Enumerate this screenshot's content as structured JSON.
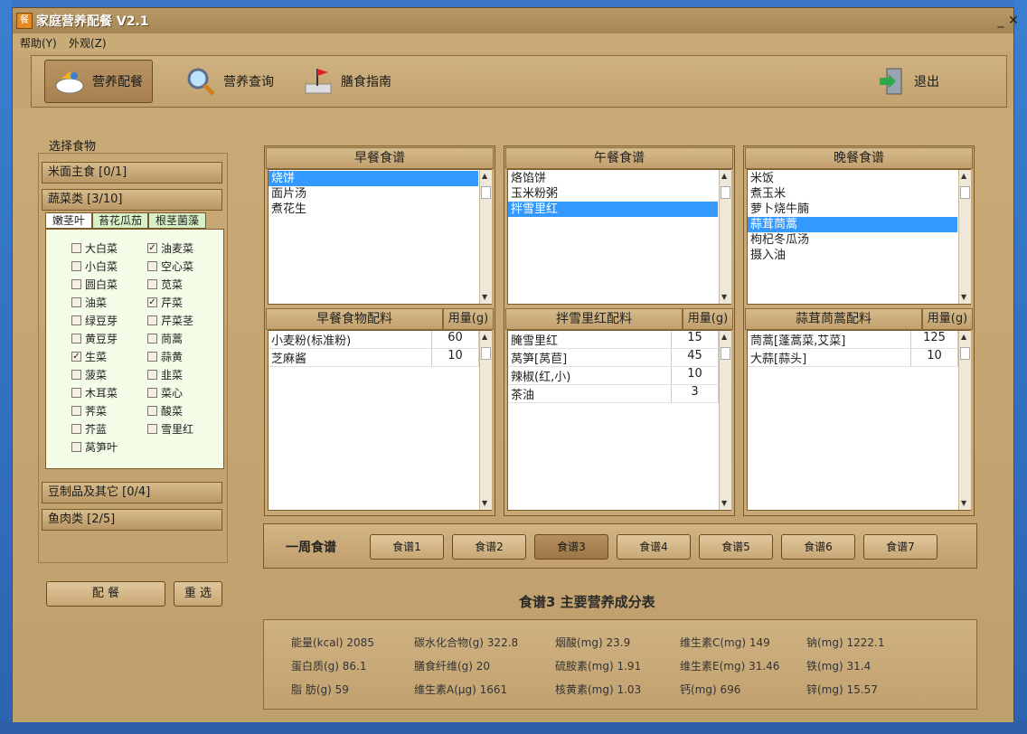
{
  "window": {
    "title": "家庭营养配餐 V2.1",
    "icon_char": "餐"
  },
  "menu": [
    "帮助(Y)",
    "外观(Z)"
  ],
  "toolbar": {
    "items": [
      {
        "label": "营养配餐",
        "icon": "bowl-icon"
      },
      {
        "label": "营养查询",
        "icon": "magnifier-icon"
      },
      {
        "label": "膳食指南",
        "icon": "flag-book-icon"
      },
      {
        "label": "退出",
        "icon": "exit-door-icon"
      }
    ]
  },
  "food_select": {
    "title": "选择食物",
    "categories": [
      "米面主食 [0/1]",
      "蔬菜类 [3/10]",
      "豆制品及其它 [0/4]",
      "鱼肉类 [2/5]"
    ],
    "tabs": [
      "嫩茎叶",
      "苔花瓜茄",
      "根茎菌藻"
    ],
    "vegetables": [
      {
        "name": "大白菜",
        "checked": false
      },
      {
        "name": "油麦菜",
        "checked": true
      },
      {
        "name": "小白菜",
        "checked": false
      },
      {
        "name": "空心菜",
        "checked": false
      },
      {
        "name": "圆白菜",
        "checked": false
      },
      {
        "name": "苋菜",
        "checked": false
      },
      {
        "name": "油菜",
        "checked": false
      },
      {
        "name": "芹菜",
        "checked": true
      },
      {
        "name": "绿豆芽",
        "checked": false
      },
      {
        "name": "芹菜茎",
        "checked": false
      },
      {
        "name": "黄豆芽",
        "checked": false
      },
      {
        "name": "茼蒿",
        "checked": false
      },
      {
        "name": "生菜",
        "checked": true
      },
      {
        "name": "蒜黄",
        "checked": false
      },
      {
        "name": "菠菜",
        "checked": false
      },
      {
        "name": "韭菜",
        "checked": false
      },
      {
        "name": "木耳菜",
        "checked": false
      },
      {
        "name": "菜心",
        "checked": false
      },
      {
        "name": "荠菜",
        "checked": false
      },
      {
        "name": "酸菜",
        "checked": false
      },
      {
        "name": "芥蓝",
        "checked": false
      },
      {
        "name": "雪里红",
        "checked": false
      },
      {
        "name": "莴笋叶",
        "checked": false
      }
    ]
  },
  "buttons": {
    "match": "配 餐",
    "reset": "重 选"
  },
  "breakfast": {
    "title": "早餐食谱",
    "items": [
      "烧饼",
      "面片汤",
      "煮花生"
    ],
    "selected": 0,
    "ingredients_title": "早餐食物配料",
    "amount_header": "用量(g)",
    "ingredients": [
      {
        "name": "小麦粉(标准粉)",
        "amount": "60"
      },
      {
        "name": "芝麻酱",
        "amount": "10"
      }
    ]
  },
  "lunch": {
    "title": "午餐食谱",
    "items": [
      "烙馅饼",
      "玉米粉粥",
      "拌雪里红"
    ],
    "selected": 2,
    "ingredients_title": "拌雪里红配料",
    "amount_header": "用量(g)",
    "ingredients": [
      {
        "name": "腌雪里红",
        "amount": "15"
      },
      {
        "name": "莴笋[莴苣]",
        "amount": "45"
      },
      {
        "name": "辣椒(红,小)",
        "amount": "10"
      },
      {
        "name": "茶油",
        "amount": "3"
      }
    ]
  },
  "dinner": {
    "title": "晚餐食谱",
    "items": [
      "米饭",
      "煮玉米",
      "萝卜烧牛腩",
      "蒜茸茼蒿",
      "枸杞冬瓜汤",
      "摄入油"
    ],
    "selected": 3,
    "ingredients_title": "蒜茸茼蒿配料",
    "amount_header": "用量(g)",
    "ingredients": [
      {
        "name": "茼蒿[蓬蒿菜,艾菜]",
        "amount": "125"
      },
      {
        "name": "大蒜[蒜头]",
        "amount": "10"
      }
    ]
  },
  "week": {
    "title": "一周食谱",
    "recipes": [
      "食谱1",
      "食谱2",
      "食谱3",
      "食谱4",
      "食谱5",
      "食谱6",
      "食谱7"
    ],
    "active": 2
  },
  "nutrition": {
    "title": "食谱3 主要营养成分表",
    "rows": [
      [
        "能量(kcal) 2085",
        "碳水化合物(g) 322.8",
        "烟酸(mg)  23.9",
        "维生素C(mg) 149",
        "钠(mg)  1222.1"
      ],
      [
        "蛋白质(g)  86.1",
        "膳食纤维(g)   20",
        "硫胺素(mg) 1.91",
        "维生素E(mg) 31.46",
        "铁(mg)  31.4"
      ],
      [
        "脂  肪(g)  59",
        "维生素A(μg)  1661",
        "核黄素(mg) 1.03",
        "钙(mg)  696",
        "锌(mg)  15.57"
      ]
    ]
  }
}
